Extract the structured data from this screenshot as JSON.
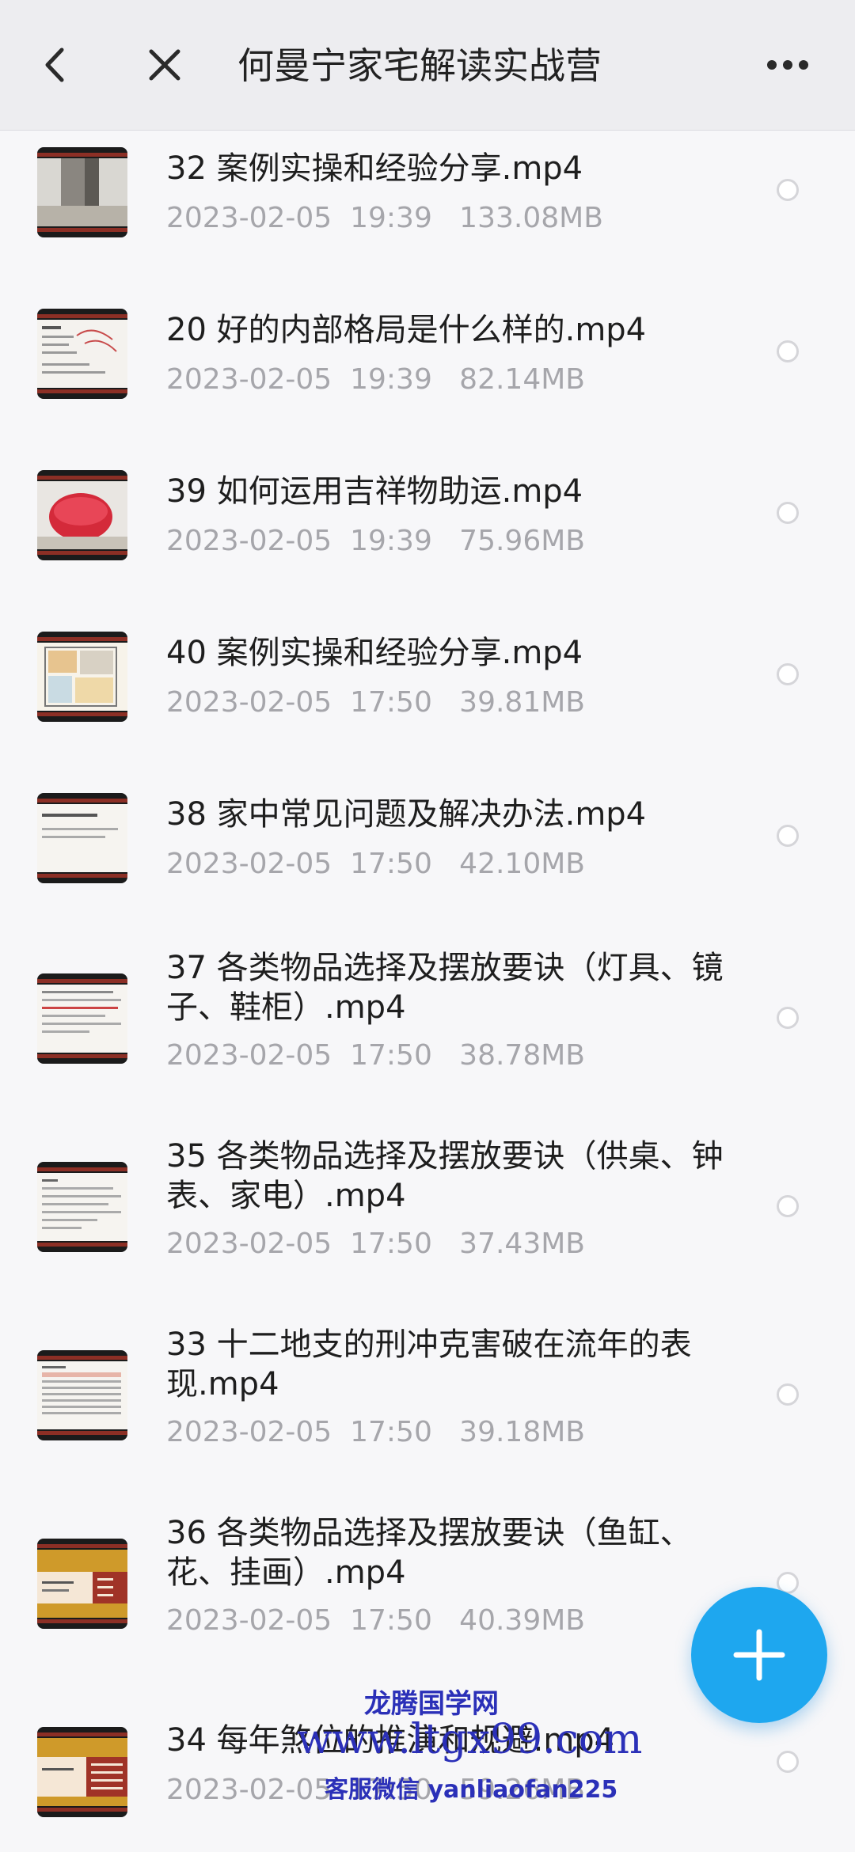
{
  "header": {
    "title": "何曼宁家宅解读实战营",
    "back_icon": "chevron-left-icon",
    "close_icon": "close-icon",
    "more_icon": "more-dots-icon"
  },
  "files": [
    {
      "name": "32 案例实操和经验分享.mp4",
      "meta": "2023-02-05  19:39   133.08MB"
    },
    {
      "name": "20 好的内部格局是什么样的.mp4",
      "meta": "2023-02-05  19:39   82.14MB"
    },
    {
      "name": "39 如何运用吉祥物助运.mp4",
      "meta": "2023-02-05  19:39   75.96MB"
    },
    {
      "name": "40 案例实操和经验分享.mp4",
      "meta": "2023-02-05  17:50   39.81MB"
    },
    {
      "name": "38 家中常见问题及解决办法.mp4",
      "meta": "2023-02-05  17:50   42.10MB"
    },
    {
      "name": "37 各类物品选择及摆放要诀（灯具、镜子、鞋柜）.mp4",
      "meta": "2023-02-05  17:50   38.78MB"
    },
    {
      "name": "35 各类物品选择及摆放要诀（供桌、钟表、家电）.mp4",
      "meta": "2023-02-05  17:50   37.43MB"
    },
    {
      "name": "33 十二地支的刑冲克害破在流年的表现.mp4",
      "meta": "2023-02-05  17:50   39.18MB"
    },
    {
      "name": "36 各类物品选择及摆放要诀（鱼缸、花、挂画）.mp4",
      "meta": "2023-02-05  17:50   40.39MB"
    },
    {
      "name": "34 每年煞位的推演和规避.mp4",
      "meta": "2023-02-05  17:50   59.26MB"
    }
  ],
  "fab": {
    "icon": "plus-icon"
  },
  "watermark": {
    "line1": "龙腾国学网",
    "line2": "www.ltgx99.com",
    "line3": "客服微信 yanliaofan225"
  },
  "colors": {
    "accent": "#1ea7ef",
    "meta_text": "#a6a6ab",
    "header_bg": "#ededf0",
    "watermark": "#2b30b8"
  }
}
